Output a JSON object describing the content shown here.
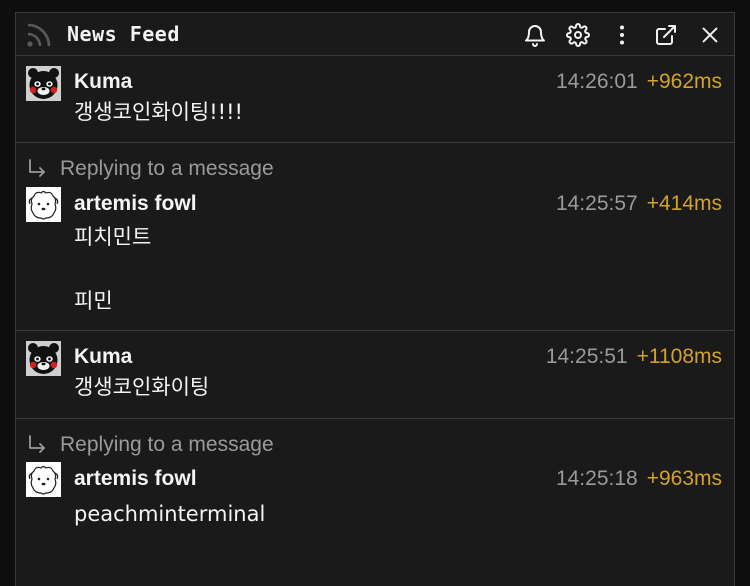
{
  "header": {
    "title": "News Feed",
    "icons": [
      "rss-icon",
      "bell-icon",
      "gear-icon",
      "more-vertical-icon",
      "popout-icon",
      "close-icon"
    ]
  },
  "messages": [
    {
      "author": "Kuma",
      "time": "14:26:01",
      "delta": "+962ms",
      "body": "갱생코인화이팅!!!!",
      "reply": null
    },
    {
      "author": "artemis fowl",
      "time": "14:25:57",
      "delta": "+414ms",
      "body": "피치민트\n\n피민",
      "reply": "Replying to a message"
    },
    {
      "author": "Kuma",
      "time": "14:25:51",
      "delta": "+1108ms",
      "body": "갱생코인화이팅",
      "reply": null
    },
    {
      "author": "artemis fowl",
      "time": "14:25:18",
      "delta": "+963ms",
      "body": "peachminterminal",
      "reply": "Replying to a message"
    }
  ],
  "colors": {
    "background": "#1a1a1a",
    "border": "#3a3a3a",
    "text": "#f4f4f4",
    "muted": "#9a9a9a",
    "delta": "#d4a12a"
  }
}
